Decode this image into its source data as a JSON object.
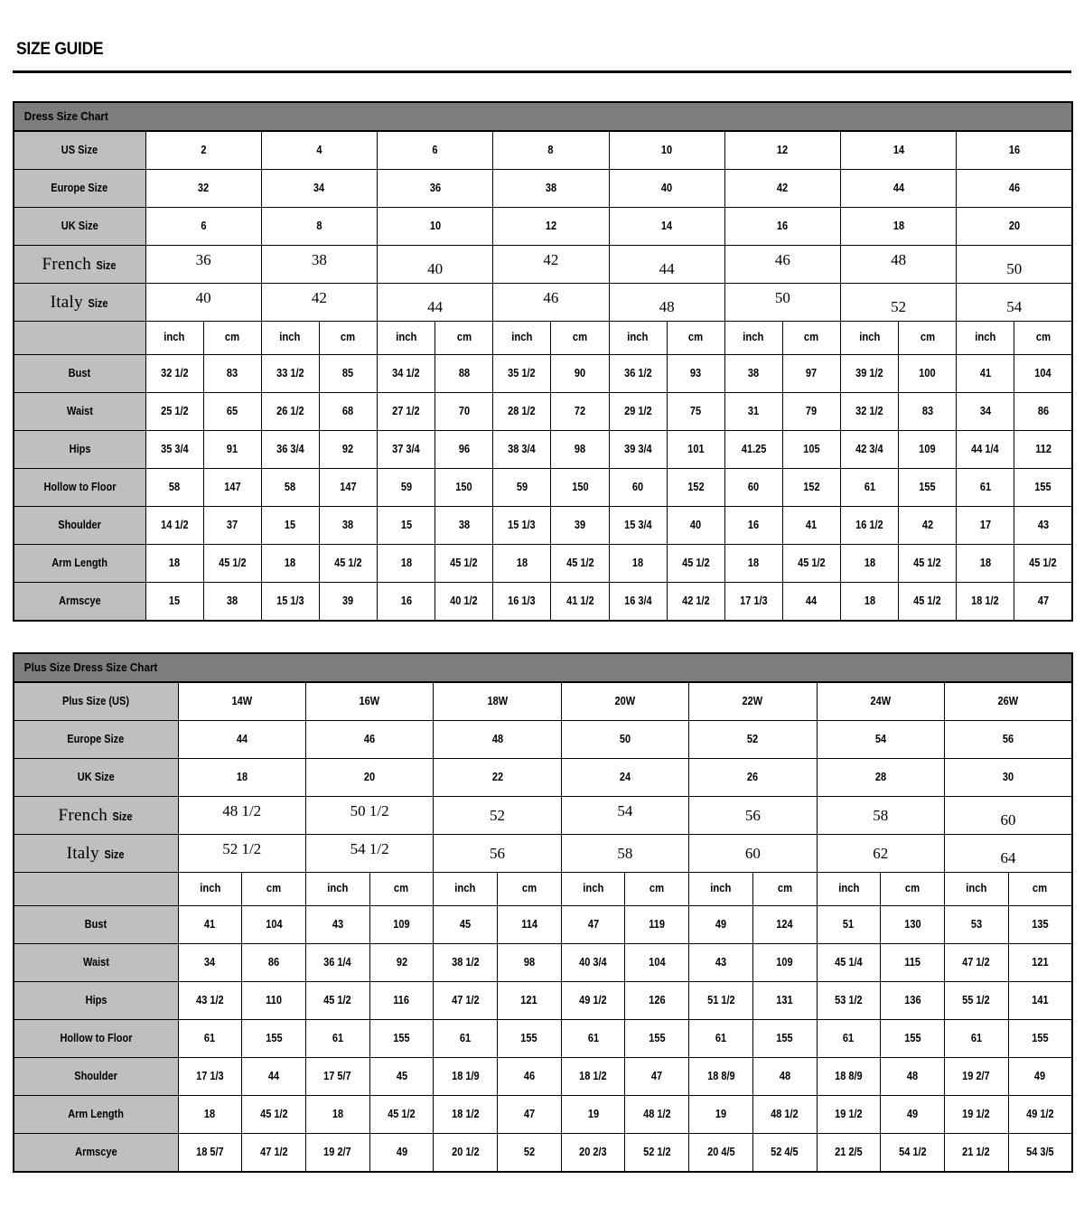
{
  "page": {
    "title": "SIZE GUIDE"
  },
  "units": {
    "inch": "inch",
    "cm": "cm"
  },
  "chart_data": [
    {
      "type": "table",
      "title": "Dress Size Chart",
      "id": "dress-size-chart",
      "size_rows": [
        {
          "label": "US Size",
          "style": "sans",
          "values": [
            "2",
            "4",
            "6",
            "8",
            "10",
            "12",
            "14",
            "16"
          ]
        },
        {
          "label": "Europe Size",
          "style": "sans",
          "values": [
            "32",
            "34",
            "36",
            "38",
            "40",
            "42",
            "44",
            "46"
          ]
        },
        {
          "label": "UK Size",
          "style": "sans",
          "values": [
            "6",
            "8",
            "10",
            "12",
            "14",
            "16",
            "18",
            "20"
          ]
        },
        {
          "label_country": "French",
          "label_suffix": "Size",
          "style": "serif",
          "values": [
            "36",
            "38",
            "40",
            "42",
            "44",
            "46",
            "48",
            "50"
          ],
          "offsets": [
            "up",
            "up",
            "down",
            "up",
            "down",
            "up",
            "up",
            "down"
          ]
        },
        {
          "label_country": "Italy",
          "label_suffix": "Size",
          "style": "serif",
          "values": [
            "40",
            "42",
            "44",
            "46",
            "48",
            "50",
            "52",
            "54"
          ],
          "offsets": [
            "up",
            "up",
            "down",
            "up",
            "down",
            "up",
            "down",
            "down"
          ]
        }
      ],
      "unit_header": [
        "inch",
        "cm",
        "inch",
        "cm",
        "inch",
        "cm",
        "inch",
        "cm",
        "inch",
        "cm",
        "inch",
        "cm",
        "inch",
        "cm",
        "inch",
        "cm"
      ],
      "measurement_rows": [
        {
          "label": "Bust",
          "values": [
            "32 1/2",
            "83",
            "33 1/2",
            "85",
            "34 1/2",
            "88",
            "35 1/2",
            "90",
            "36 1/2",
            "93",
            "38",
            "97",
            "39 1/2",
            "100",
            "41",
            "104"
          ]
        },
        {
          "label": "Waist",
          "values": [
            "25 1/2",
            "65",
            "26 1/2",
            "68",
            "27 1/2",
            "70",
            "28 1/2",
            "72",
            "29 1/2",
            "75",
            "31",
            "79",
            "32 1/2",
            "83",
            "34",
            "86"
          ]
        },
        {
          "label": "Hips",
          "values": [
            "35 3/4",
            "91",
            "36 3/4",
            "92",
            "37 3/4",
            "96",
            "38 3/4",
            "98",
            "39 3/4",
            "101",
            "41.25",
            "105",
            "42 3/4",
            "109",
            "44 1/4",
            "112"
          ]
        },
        {
          "label": "Hollow to Floor",
          "values": [
            "58",
            "147",
            "58",
            "147",
            "59",
            "150",
            "59",
            "150",
            "60",
            "152",
            "60",
            "152",
            "61",
            "155",
            "61",
            "155"
          ]
        },
        {
          "label": "Shoulder",
          "values": [
            "14 1/2",
            "37",
            "15",
            "38",
            "15",
            "38",
            "15 1/3",
            "39",
            "15 3/4",
            "40",
            "16",
            "41",
            "16 1/2",
            "42",
            "17",
            "43"
          ]
        },
        {
          "label": "Arm Length",
          "values": [
            "18",
            "45 1/2",
            "18",
            "45 1/2",
            "18",
            "45 1/2",
            "18",
            "45 1/2",
            "18",
            "45 1/2",
            "18",
            "45 1/2",
            "18",
            "45 1/2",
            "18",
            "45 1/2"
          ]
        },
        {
          "label": "Armscye",
          "values": [
            "15",
            "38",
            "15 1/3",
            "39",
            "16",
            "40 1/2",
            "16 1/3",
            "41 1/2",
            "16 3/4",
            "42 1/2",
            "17 1/3",
            "44",
            "18",
            "45 1/2",
            "18 1/2",
            "47"
          ]
        }
      ]
    },
    {
      "type": "table",
      "title": "Plus Size Dress Size Chart",
      "id": "plus-size-dress-size-chart",
      "size_rows": [
        {
          "label": "Plus Size (US)",
          "style": "sans",
          "values": [
            "14W",
            "16W",
            "18W",
            "20W",
            "22W",
            "24W",
            "26W"
          ]
        },
        {
          "label": "Europe Size",
          "style": "sans",
          "values": [
            "44",
            "46",
            "48",
            "50",
            "52",
            "54",
            "56"
          ]
        },
        {
          "label": "UK Size",
          "style": "sans",
          "values": [
            "18",
            "20",
            "22",
            "24",
            "26",
            "28",
            "30"
          ]
        },
        {
          "label_country": "French",
          "label_suffix": "Size",
          "style": "serif",
          "values": [
            "48  1/2",
            "50  1/2",
            "52",
            "54",
            "56",
            "58",
            "60"
          ],
          "offsets": [
            "up",
            "up",
            "mid",
            "up",
            "mid",
            "mid",
            "down"
          ]
        },
        {
          "label_country": "Italy",
          "label_suffix": "Size",
          "style": "serif",
          "values": [
            "52  1/2",
            "54  1/2",
            "56",
            "58",
            "60",
            "62",
            "64"
          ],
          "offsets": [
            "up",
            "up",
            "mid",
            "mid",
            "mid",
            "mid",
            "down"
          ]
        }
      ],
      "unit_header": [
        "inch",
        "cm",
        "inch",
        "cm",
        "inch",
        "cm",
        "inch",
        "cm",
        "inch",
        "cm",
        "inch",
        "cm",
        "inch",
        "cm"
      ],
      "measurement_rows": [
        {
          "label": "Bust",
          "values": [
            "41",
            "104",
            "43",
            "109",
            "45",
            "114",
            "47",
            "119",
            "49",
            "124",
            "51",
            "130",
            "53",
            "135"
          ]
        },
        {
          "label": "Waist",
          "values": [
            "34",
            "86",
            "36 1/4",
            "92",
            "38 1/2",
            "98",
            "40 3/4",
            "104",
            "43",
            "109",
            "45 1/4",
            "115",
            "47 1/2",
            "121"
          ]
        },
        {
          "label": "Hips",
          "values": [
            "43 1/2",
            "110",
            "45 1/2",
            "116",
            "47 1/2",
            "121",
            "49 1/2",
            "126",
            "51 1/2",
            "131",
            "53 1/2",
            "136",
            "55 1/2",
            "141"
          ]
        },
        {
          "label": "Hollow to Floor",
          "values": [
            "61",
            "155",
            "61",
            "155",
            "61",
            "155",
            "61",
            "155",
            "61",
            "155",
            "61",
            "155",
            "61",
            "155"
          ]
        },
        {
          "label": "Shoulder",
          "values": [
            "17 1/3",
            "44",
            "17 5/7",
            "45",
            "18 1/9",
            "46",
            "18 1/2",
            "47",
            "18 8/9",
            "48",
            "18 8/9",
            "48",
            "19 2/7",
            "49"
          ]
        },
        {
          "label": "Arm Length",
          "values": [
            "18",
            "45 1/2",
            "18",
            "45 1/2",
            "18 1/2",
            "47",
            "19",
            "48 1/2",
            "19",
            "48 1/2",
            "19 1/2",
            "49",
            "19 1/2",
            "49 1/2"
          ]
        },
        {
          "label": "Armscye",
          "values": [
            "18 5/7",
            "47 1/2",
            "19 2/7",
            "49",
            "20 1/2",
            "52",
            "20 2/3",
            "52 1/2",
            "20 4/5",
            "52 4/5",
            "21 2/5",
            "54 1/2",
            "21 1/2",
            "54 3/5"
          ]
        }
      ]
    }
  ],
  "colors": {
    "title_bar": "#7d7d7d",
    "row_label": "#bfbfbf",
    "border": "#000000",
    "background": "#ffffff"
  }
}
